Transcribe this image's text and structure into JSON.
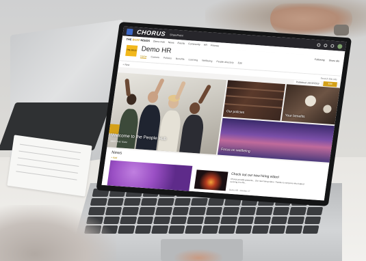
{
  "suite_bar": {
    "brand": "CHORUS",
    "app_name": "SharePoint"
  },
  "hub_nav": {
    "logo_prefix": "THE",
    "logo_accent": "BUZZ",
    "logo_suffix": "NEEDS",
    "items": [
      "Demo Hub",
      "News",
      "Events",
      "Community",
      "HR",
      "Finance"
    ]
  },
  "site": {
    "logo_text": "THE BUZZ",
    "title": "Demo HR",
    "nav": [
      "Home",
      "Careers",
      "Policies",
      "Benefits",
      "Learning",
      "Wellbeing",
      "People directory",
      "Edit"
    ],
    "actions": {
      "following": "Following",
      "share": "Share site"
    }
  },
  "command_bar": {
    "new_label": "+ New",
    "search_placeholder": "Search this site"
  },
  "page": {
    "published": "Published 10/10/2019",
    "edit": "Edit"
  },
  "hero": {
    "main_caption": "Welcome to the People Hub",
    "main_sub": "MEET THE TEAM",
    "tiles": [
      {
        "label": "Our policies"
      },
      {
        "label": "Your benefits"
      },
      {
        "label": "Focus on wellbeing"
      }
    ]
  },
  "news": {
    "title": "News",
    "add_label": "+ Add",
    "story": {
      "title": "Check out our new hiring video!",
      "body": "Chorus proudly presents... Our new hiring video. Thanks to everyone who helped us bring it to life...",
      "meta": "Demo HR · October 17"
    }
  }
}
